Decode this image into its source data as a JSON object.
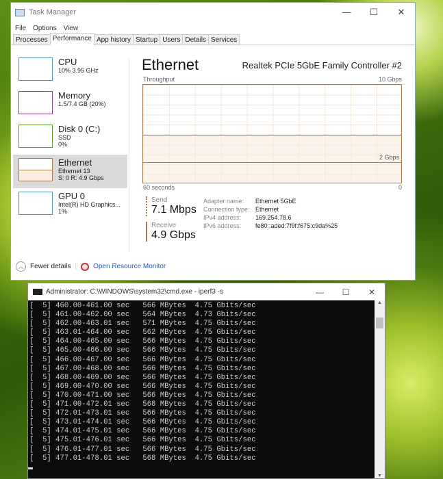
{
  "task_manager": {
    "title": "Task Manager",
    "window_buttons": [
      "—",
      "☐",
      "✕"
    ],
    "menu": [
      "File",
      "Options",
      "View"
    ],
    "tabs": [
      "Processes",
      "Performance",
      "App history",
      "Startup",
      "Users",
      "Details",
      "Services"
    ],
    "active_tab": "Performance",
    "sidebar": [
      {
        "name": "CPU",
        "sub1": "10%  3.95 GHz",
        "sub2": "",
        "color": "#4a90b8"
      },
      {
        "name": "Memory",
        "sub1": "1.5/7.4 GB (20%)",
        "sub2": "",
        "color": "#8b3a9c"
      },
      {
        "name": "Disk 0 (C:)",
        "sub1": "SSD",
        "sub2": "0%",
        "color": "#5a9a2a"
      },
      {
        "name": "Ethernet",
        "sub1": "Ethernet 13",
        "sub2": "S: 0 R: 4.9 Gbps",
        "color": "#a57a4c"
      },
      {
        "name": "GPU 0",
        "sub1": "Intel(R) HD Graphics...",
        "sub2": "1%",
        "color": "#4a90b8"
      }
    ],
    "detail": {
      "title": "Ethernet",
      "adapter": "Realtek PCIe 5GbE Family Controller #2",
      "throughput_label": "Throughput",
      "max_label": "10 Gbps",
      "secondary_label": "2 Gbps",
      "time_label": "60 seconds",
      "zero_label": "0",
      "receive_fraction": 0.49,
      "send_label": "Send",
      "send_value": "7.1 Mbps",
      "receive_label": "Receive",
      "receive_value": "4.9 Gbps",
      "props": [
        [
          "Adapter name:",
          "Ethernet 5GbE"
        ],
        [
          "Connection type:",
          "Ethernet"
        ],
        [
          "IPv4 address:",
          "169.254.78.6"
        ],
        [
          "IPv6 address:",
          "fe80::aded:7f9f:f675:c9da%25"
        ]
      ]
    },
    "fewer_details": "Fewer details",
    "open_resource_monitor": "Open Resource Monitor"
  },
  "cmd": {
    "title": "Administrator: C:\\WINDOWS\\system32\\cmd.exe - iperf3  -s",
    "window_buttons": [
      "—",
      "☐",
      "✕"
    ],
    "lines": [
      "[  5] 460.00-461.00 sec   566 MBytes  4.75 Gbits/sec",
      "[  5] 461.00-462.00 sec   564 MBytes  4.73 Gbits/sec",
      "[  5] 462.00-463.01 sec   571 MBytes  4.75 Gbits/sec",
      "[  5] 463.01-464.00 sec   562 MBytes  4.75 Gbits/sec",
      "[  5] 464.00-465.00 sec   566 MBytes  4.75 Gbits/sec",
      "[  5] 465.00-466.00 sec   566 MBytes  4.75 Gbits/sec",
      "[  5] 466.00-467.00 sec   566 MBytes  4.75 Gbits/sec",
      "[  5] 467.00-468.00 sec   566 MBytes  4.75 Gbits/sec",
      "[  5] 468.00-469.00 sec   566 MBytes  4.75 Gbits/sec",
      "[  5] 469.00-470.00 sec   566 MBytes  4.75 Gbits/sec",
      "[  5] 470.00-471.00 sec   566 MBytes  4.75 Gbits/sec",
      "[  5] 471.00-472.01 sec   568 MBytes  4.75 Gbits/sec",
      "[  5] 472.01-473.01 sec   566 MBytes  4.75 Gbits/sec",
      "[  5] 473.01-474.01 sec   566 MBytes  4.75 Gbits/sec",
      "[  5] 474.01-475.01 sec   566 MBytes  4.75 Gbits/sec",
      "[  5] 475.01-476.01 sec   566 MBytes  4.75 Gbits/sec",
      "[  5] 476.01-477.01 sec   566 MBytes  4.75 Gbits/sec",
      "[  5] 477.01-478.01 sec   568 MBytes  4.75 Gbits/sec"
    ]
  }
}
